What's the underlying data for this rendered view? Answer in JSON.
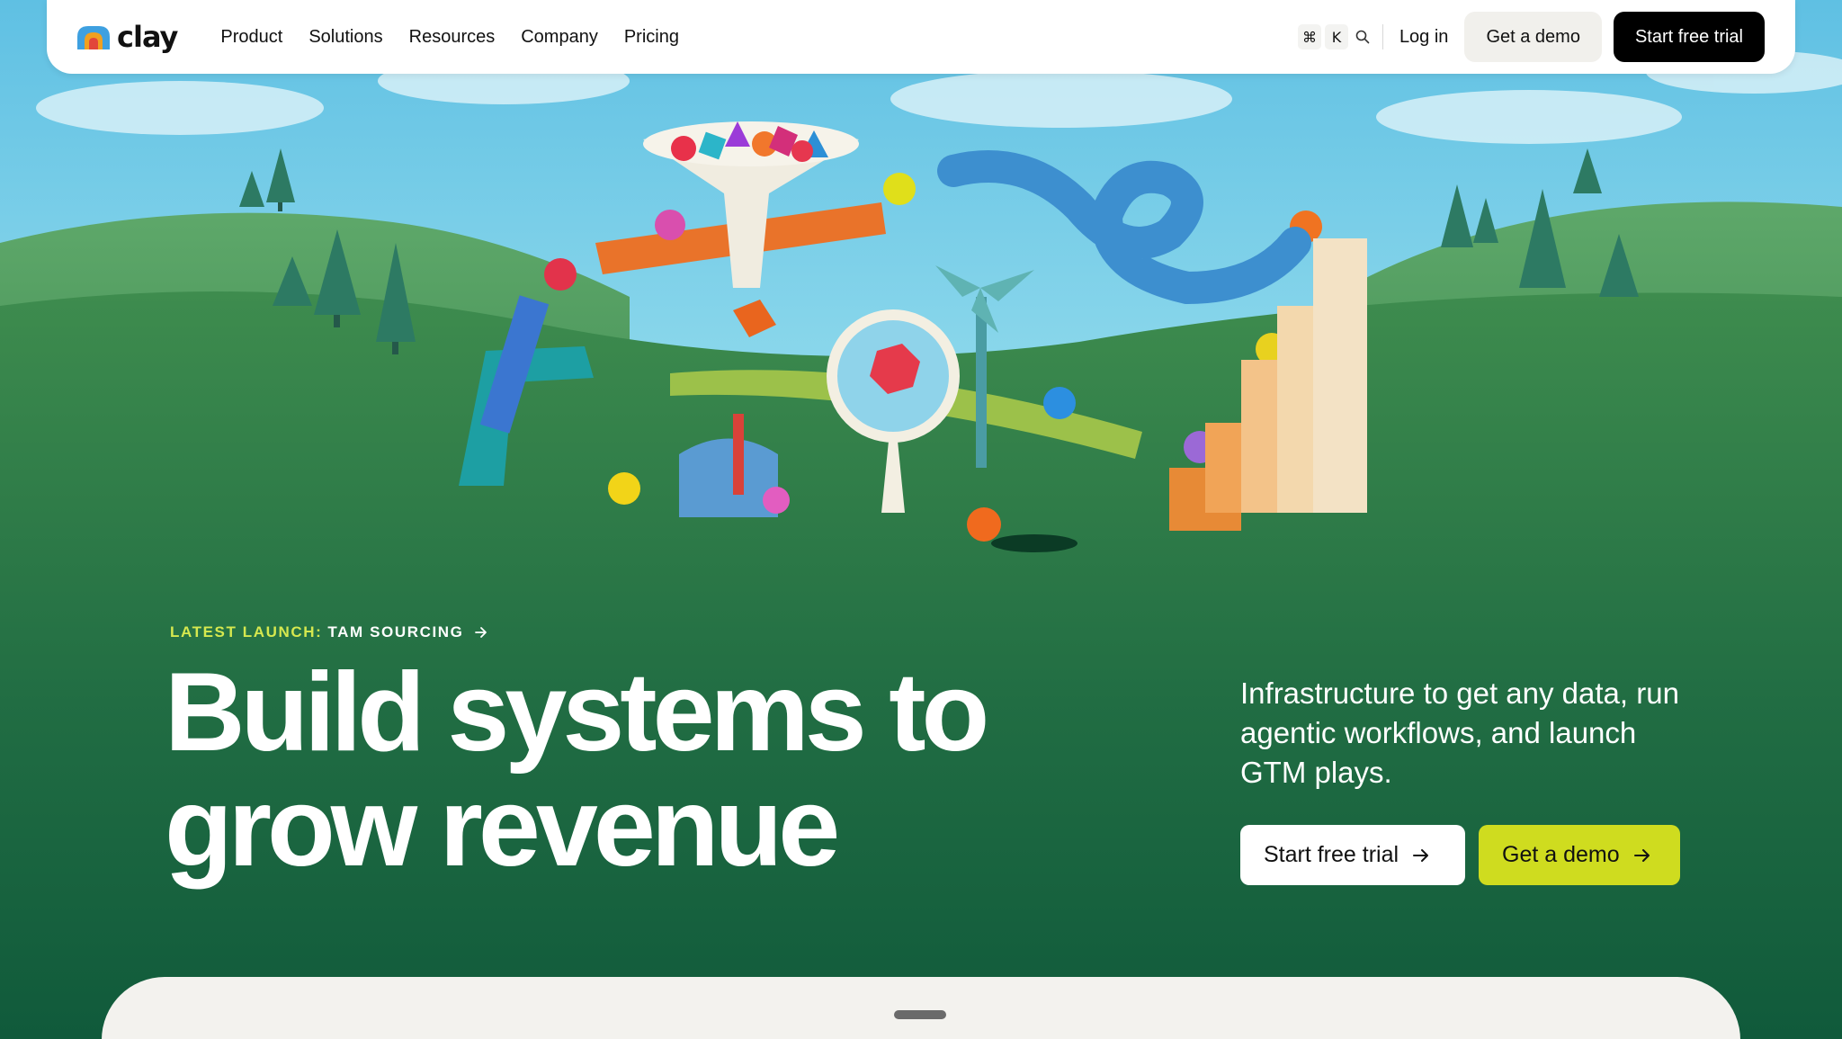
{
  "header": {
    "logo_text": "clay",
    "nav": [
      {
        "label": "Product"
      },
      {
        "label": "Solutions"
      },
      {
        "label": "Resources"
      },
      {
        "label": "Company"
      },
      {
        "label": "Pricing"
      }
    ],
    "shortcut_keys": [
      "⌘",
      "K"
    ],
    "search_icon": "search-icon",
    "login_label": "Log in",
    "demo_label": "Get a demo",
    "trial_label": "Start free trial"
  },
  "hero": {
    "launch_prefix": "LATEST LAUNCH:",
    "launch_name": "TAM SOURCING",
    "headline_line1": "Build systems to",
    "headline_line2": "grow revenue",
    "subhead": "Infrastructure to get any data, run agentic workflows, and launch GTM plays.",
    "cta_trial": "Start free trial",
    "cta_demo": "Get a demo"
  },
  "colors": {
    "dark_green": "#0f5a3a",
    "lime_accent": "#cfdc1f",
    "launch_accent": "#d6e84f",
    "sky": "#6fcde9",
    "card_bg": "#f3f2ee"
  },
  "icons": {
    "arrow": "arrow-right-icon",
    "search": "search-icon",
    "logo": "clay-logo-icon"
  }
}
